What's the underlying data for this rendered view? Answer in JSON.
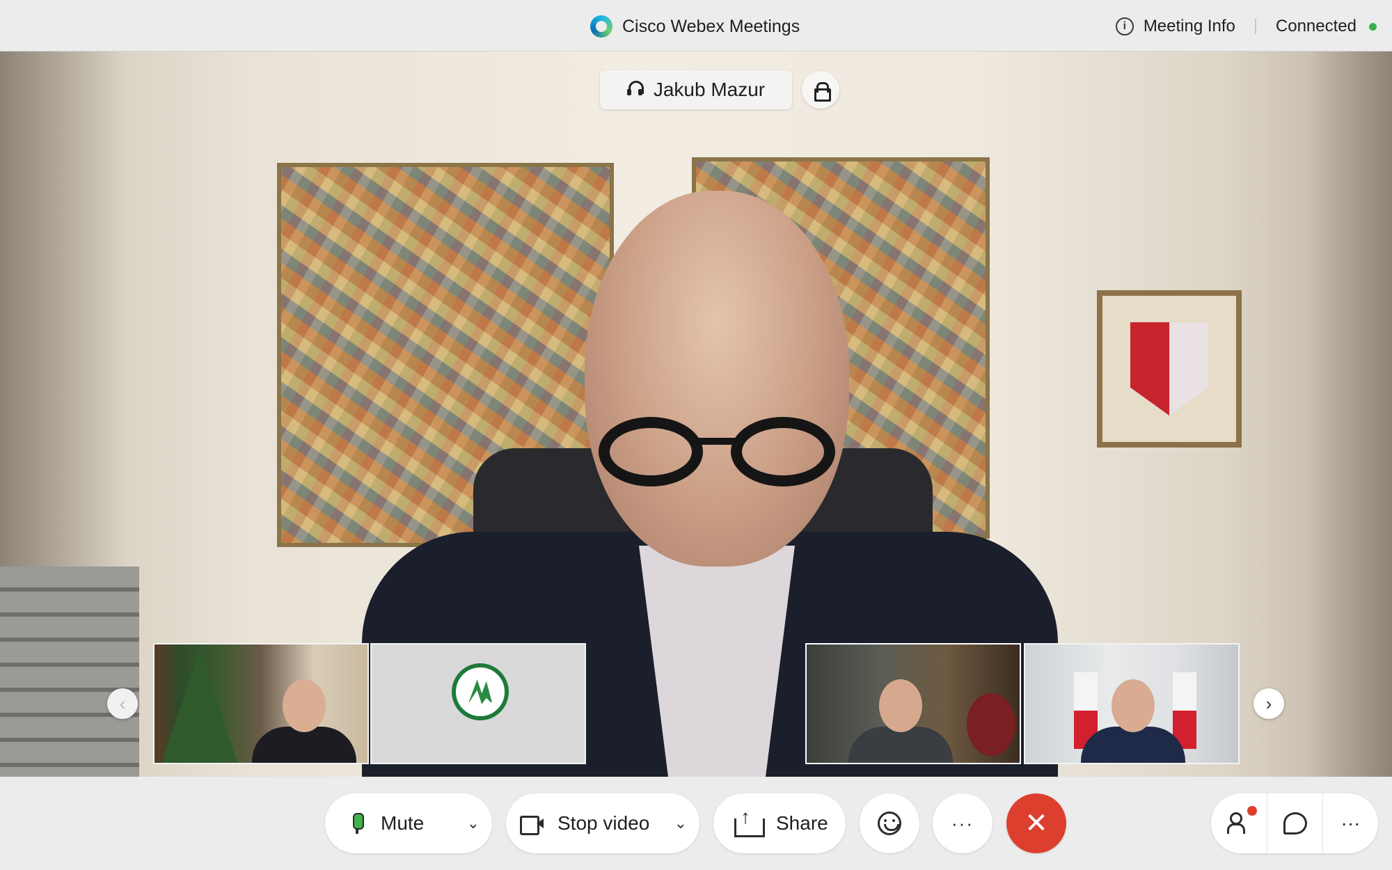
{
  "app": {
    "title": "Cisco Webex Meetings",
    "meeting_info_label": "Meeting Info",
    "connection_status": "Connected",
    "status_color": "#38b34a"
  },
  "stage": {
    "active_speaker": "Jakub Mazur",
    "speaker_icon": "headset-icon",
    "lock_icon": "lock-icon"
  },
  "filmstrip": {
    "prev_icon": "chevron-left-icon",
    "next_icon": "chevron-right-icon",
    "prev_glyph": "‹",
    "next_glyph": "›",
    "thumbnails": [
      {
        "kind": "video"
      },
      {
        "kind": "logo"
      },
      {
        "kind": "video"
      },
      {
        "kind": "video"
      }
    ]
  },
  "controls": {
    "mute_label": "Mute",
    "stop_video_label": "Stop video",
    "share_label": "Share",
    "more_glyph": "···",
    "end_glyph": "✕",
    "caret_glyph": "⌄",
    "end_color": "#dd3f2e",
    "icons": {
      "mute": "microphone-icon",
      "video": "camera-icon",
      "share": "share-icon",
      "reactions": "emoji-icon",
      "more": "more-icon",
      "end": "close-icon",
      "participants": "participants-icon",
      "chat": "chat-icon",
      "panel_more": "more-icon"
    }
  }
}
